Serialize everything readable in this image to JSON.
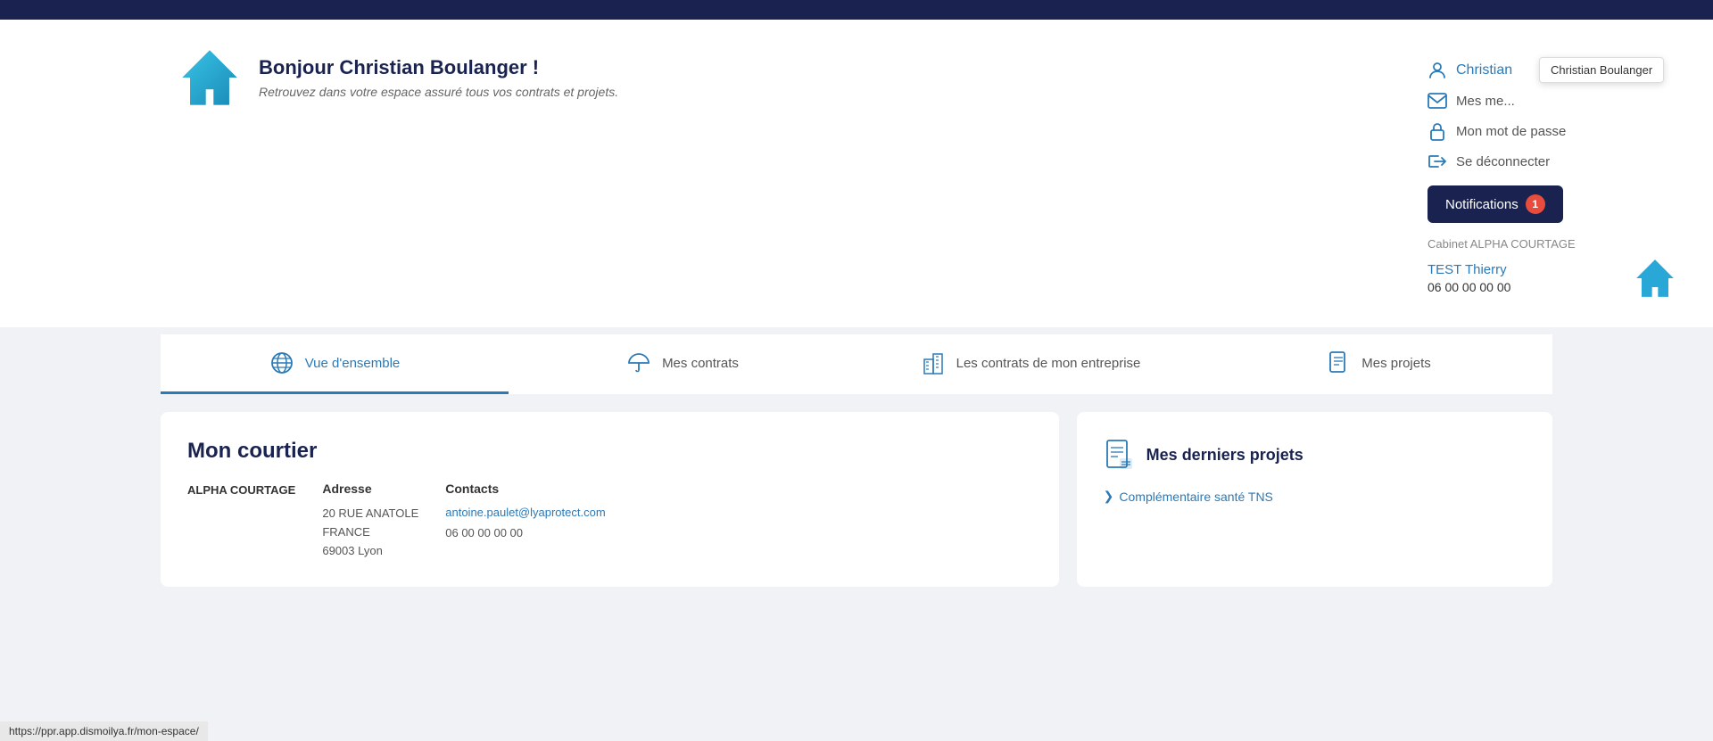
{
  "topbar": {},
  "header": {
    "greeting": "Bonjour Christian Boulanger !",
    "subtitle": "Retrouvez dans votre espace assuré tous vos contrats et projets.",
    "user": {
      "name": "Christian",
      "full_name": "Christian Boulanger",
      "tooltip": "Christian Boulanger"
    },
    "menu": {
      "profile_label": "Christian",
      "messages_label": "Mes me...",
      "password_label": "Mon mot de passe",
      "logout_label": "Se déconnecter"
    },
    "notifications": {
      "label": "Notifications",
      "count": "1"
    },
    "cabinet": {
      "label": "Cabinet ALPHA COURTAGE",
      "agent_name": "TEST Thierry",
      "agent_phone": "06 00 00 00 00"
    }
  },
  "tabs": [
    {
      "id": "vue-ensemble",
      "label": "Vue d'ensemble",
      "active": true
    },
    {
      "id": "mes-contrats",
      "label": "Mes contrats",
      "active": false
    },
    {
      "id": "contrats-entreprise",
      "label": "Les contrats de mon entreprise",
      "active": false
    },
    {
      "id": "mes-projets",
      "label": "Mes projets",
      "active": false
    }
  ],
  "courtier": {
    "title": "Mon courtier",
    "company": "ALPHA COURTAGE",
    "address": {
      "label": "Adresse",
      "line1": "20 RUE ANATOLE",
      "line2": "FRANCE",
      "city": "69003 Lyon"
    },
    "contacts": {
      "label": "Contacts",
      "email": "antoine.paulet@lyaprotect.com",
      "phone": "06 00 00 00 00"
    }
  },
  "projets": {
    "title": "Mes derniers projets",
    "items": [
      {
        "label": "Complémentaire santé TNS"
      }
    ]
  },
  "statusbar": {
    "url": "https://ppr.app.dismoilya.fr/mon-espace/"
  }
}
